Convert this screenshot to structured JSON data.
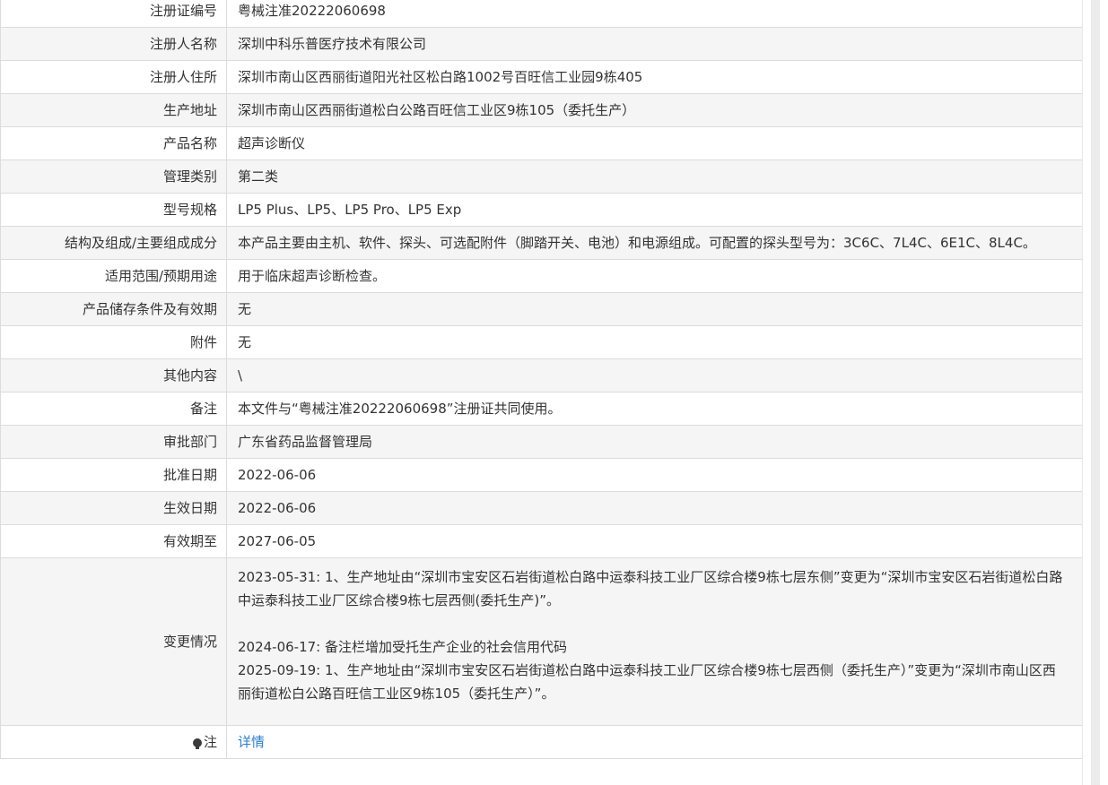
{
  "rows": [
    {
      "label": "注册证编号",
      "value": "粤械注准20222060698"
    },
    {
      "label": "注册人名称",
      "value": "深圳中科乐普医疗技术有限公司"
    },
    {
      "label": "注册人住所",
      "value": "深圳市南山区西丽街道阳光社区松白路1002号百旺信工业园9栋405"
    },
    {
      "label": "生产地址",
      "value": "深圳市南山区西丽街道松白公路百旺信工业区9栋105（委托生产）"
    },
    {
      "label": "产品名称",
      "value": "超声诊断仪"
    },
    {
      "label": "管理类别",
      "value": "第二类"
    },
    {
      "label": "型号规格",
      "value": "LP5 Plus、LP5、LP5 Pro、LP5 Exp"
    },
    {
      "label": "结构及组成/主要组成成分",
      "value": "本产品主要由主机、软件、探头、可选配附件（脚踏开关、电池）和电源组成。可配置的探头型号为：3C6C、7L4C、6E1C、8L4C。"
    },
    {
      "label": "适用范围/预期用途",
      "value": "用于临床超声诊断检查。"
    },
    {
      "label": "产品储存条件及有效期",
      "value": "无"
    },
    {
      "label": "附件",
      "value": "无"
    },
    {
      "label": "其他内容",
      "value": "\\"
    },
    {
      "label": "备注",
      "value": "本文件与“粤械注准20222060698”注册证共同使用。"
    },
    {
      "label": "审批部门",
      "value": "广东省药品监督管理局"
    },
    {
      "label": "批准日期",
      "value": "2022-06-06"
    },
    {
      "label": "生效日期",
      "value": "2022-06-06"
    },
    {
      "label": "有效期至",
      "value": "2027-06-05"
    }
  ],
  "changes": {
    "label": "变更情况",
    "entries": [
      "2023-05-31: 1、生产地址由“深圳市宝安区石岩街道松白路中运泰科技工业厂区综合楼9栋七层东侧”变更为“深圳市宝安区石岩街道松白路中运泰科技工业厂区综合楼9栋七层西侧(委托生产)”。",
      "2024-06-17: 备注栏增加受托生产企业的社会信用代码",
      "2025-09-19: 1、生产地址由“深圳市宝安区石岩街道松白路中运泰科技工业厂区综合楼9栋七层西侧（委托生产）”变更为“深圳市南山区西丽街道松白公路百旺信工业区9栋105（委托生产）”。"
    ]
  },
  "note": {
    "label": "注",
    "icon": "lightbulb-icon",
    "link_text": "详情",
    "link_color": "#2a7fd4"
  }
}
